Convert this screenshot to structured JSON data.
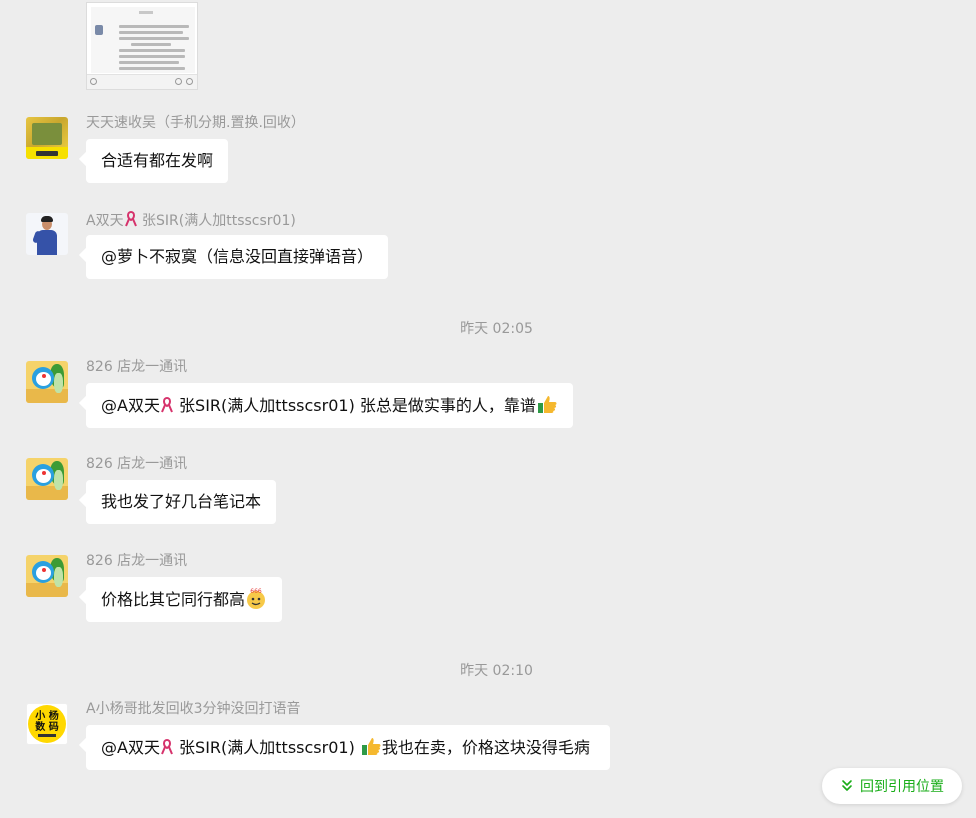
{
  "messages": [
    {
      "sender": "天天速收吴（手机分期.置换.回收）",
      "text": "合适有都在发啊",
      "avatar": "yellow-shop-logo"
    },
    {
      "sender_a": "A双天",
      "sender_b": " 张SIR(满人加ttsscsr01)",
      "text": "@萝卜不寂寞（信息没回直接弹语音）",
      "avatar": "man-in-blue-shirt"
    },
    {
      "sender": "826 店龙一通讯",
      "text_a": "@A双天",
      "text_b": " 张SIR(满人加ttsscsr01) 张总是做实事的人，靠谱",
      "avatar": "doraemon-with-cabbage"
    },
    {
      "sender": "826 店龙一通讯",
      "text": "我也发了好几台笔记本",
      "avatar": "doraemon-with-cabbage"
    },
    {
      "sender": "826 店龙一通讯",
      "text": "价格比其它同行都高",
      "avatar": "doraemon-with-cabbage"
    },
    {
      "sender": "A小杨哥批发回收3分钟没回打语音",
      "text_a": "@A双天",
      "text_b": " 张SIR(满人加ttsscsr01) ",
      "text_c": "我也在卖，价格这块没得毛病",
      "avatar_line1": "小 杨",
      "avatar_line2": "数 码"
    }
  ],
  "timestamps": [
    "昨天 02:05",
    "昨天 02:10"
  ],
  "jump_button": {
    "label": "回到引用位置"
  },
  "colors": {
    "background": "#ededed",
    "bubble": "#ffffff",
    "sender": "#999999",
    "accent": "#1aad19"
  }
}
